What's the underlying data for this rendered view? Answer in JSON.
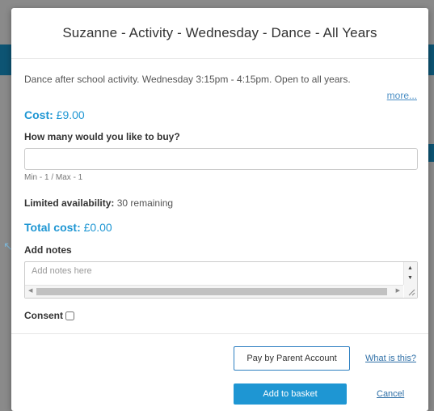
{
  "modal": {
    "title": "Suzanne - Activity - Wednesday - Dance - All Years",
    "description": "Dance after school activity. Wednesday 3:15pm - 4:15pm. Open to all years.",
    "more_link": "more...",
    "cost_label": "Cost:",
    "cost_value": "£9.00",
    "quantity_label": "How many would you like to buy?",
    "quantity_value": "",
    "min_max": "Min - 1 / Max - 1",
    "availability_label": "Limited availability:",
    "availability_value": "30 remaining",
    "total_label": "Total cost:",
    "total_value": "£0.00",
    "notes_label": "Add notes",
    "notes_placeholder": "Add notes here",
    "consent_label": "Consent",
    "consent_checked": false,
    "pay_button": "Pay by Parent Account",
    "what_link": "What is this?",
    "basket_button": "Add to basket",
    "cancel_link": "Cancel"
  },
  "colors": {
    "accent": "#1e96d3",
    "link": "#2d6ea6",
    "button_border": "#2d7fc1"
  },
  "icons": {
    "scroll_up": "triangle-up",
    "scroll_down": "triangle-down",
    "scroll_left": "triangle-left",
    "scroll_right": "triangle-right",
    "resize": "resize-grip"
  }
}
